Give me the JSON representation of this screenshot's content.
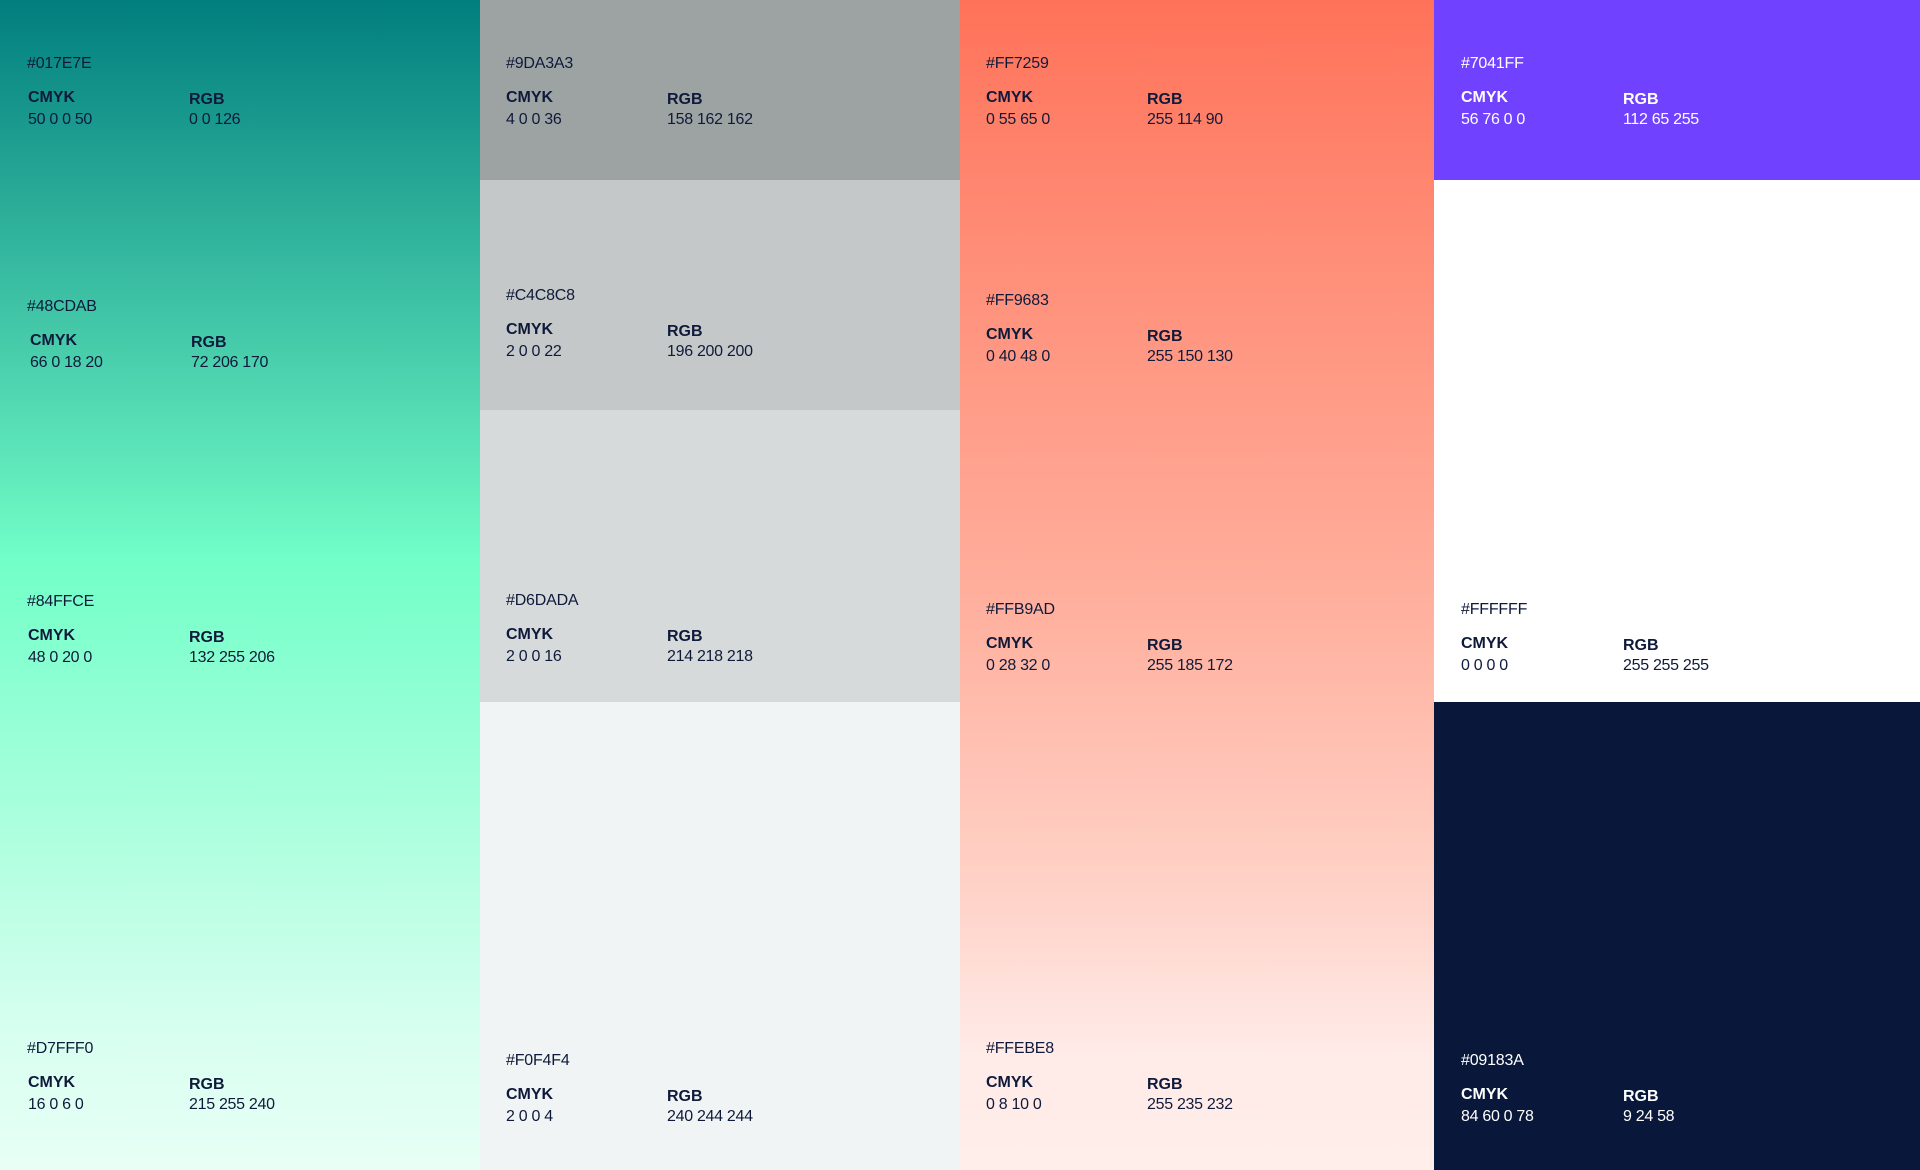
{
  "palette": {
    "teal": [
      {
        "hex": "#017E7E",
        "cmyk_label": "CMYK",
        "cmyk": "50 0 0 50",
        "rgb_label": "RGB",
        "rgb": "0 0 126"
      },
      {
        "hex": "#48CDAB",
        "cmyk_label": "CMYK",
        "cmyk": "66 0 18 20",
        "rgb_label": "RGB",
        "rgb": "72 206 170"
      },
      {
        "hex": "#84FFCE",
        "cmyk_label": "CMYK",
        "cmyk": "48 0 20 0",
        "rgb_label": "RGB",
        "rgb": "132 255 206"
      },
      {
        "hex": "#D7FFF0",
        "cmyk_label": "CMYK",
        "cmyk": "16 0 6 0",
        "rgb_label": "RGB",
        "rgb": "215 255 240"
      }
    ],
    "grey": [
      {
        "hex": "#9DA3A3",
        "cmyk_label": "CMYK",
        "cmyk": "4 0 0 36",
        "rgb_label": "RGB",
        "rgb": "158 162 162",
        "color": "#9DA3A3"
      },
      {
        "hex": "#C4C8C8",
        "cmyk_label": "CMYK",
        "cmyk": "2 0 0 22",
        "rgb_label": "RGB",
        "rgb": "196 200 200",
        "color": "#C4C8C8"
      },
      {
        "hex": "#D6DADA",
        "cmyk_label": "CMYK",
        "cmyk": "2 0 0 16",
        "rgb_label": "RGB",
        "rgb": "214 218 218",
        "color": "#D6DADA"
      },
      {
        "hex": "#F0F4F4",
        "cmyk_label": "CMYK",
        "cmyk": "2 0 0 4",
        "rgb_label": "RGB",
        "rgb": "240 244 244",
        "color": "#F0F4F4"
      }
    ],
    "coral": [
      {
        "hex": "#FF7259",
        "cmyk_label": "CMYK",
        "cmyk": "0 55 65 0",
        "rgb_label": "RGB",
        "rgb": "255 114 90"
      },
      {
        "hex": "#FF9683",
        "cmyk_label": "CMYK",
        "cmyk": "0 40 48 0",
        "rgb_label": "RGB",
        "rgb": "255 150 130"
      },
      {
        "hex": "#FFB9AD",
        "cmyk_label": "CMYK",
        "cmyk": "0 28 32 0",
        "rgb_label": "RGB",
        "rgb": "255 185 172"
      },
      {
        "hex": "#FFEBE8",
        "cmyk_label": "CMYK",
        "cmyk": "0 8 10 0",
        "rgb_label": "RGB",
        "rgb": "255 235 232"
      }
    ],
    "extra": [
      {
        "hex": "#7041FF",
        "cmyk_label": "CMYK",
        "cmyk": "56 76 0 0",
        "rgb_label": "RGB",
        "rgb": "112 65 255",
        "color": "#7041FF"
      },
      {
        "hex": "#FFFFFF",
        "cmyk_label": "CMYK",
        "cmyk": "0 0 0 0",
        "rgb_label": "RGB",
        "rgb": "255 255 255",
        "color": "#FFFFFF"
      },
      {
        "hex": "#09183A",
        "cmyk_label": "CMYK",
        "cmyk": "84 60 0 78",
        "rgb_label": "RGB",
        "rgb": "9 24 58",
        "color": "#09183A"
      }
    ]
  }
}
